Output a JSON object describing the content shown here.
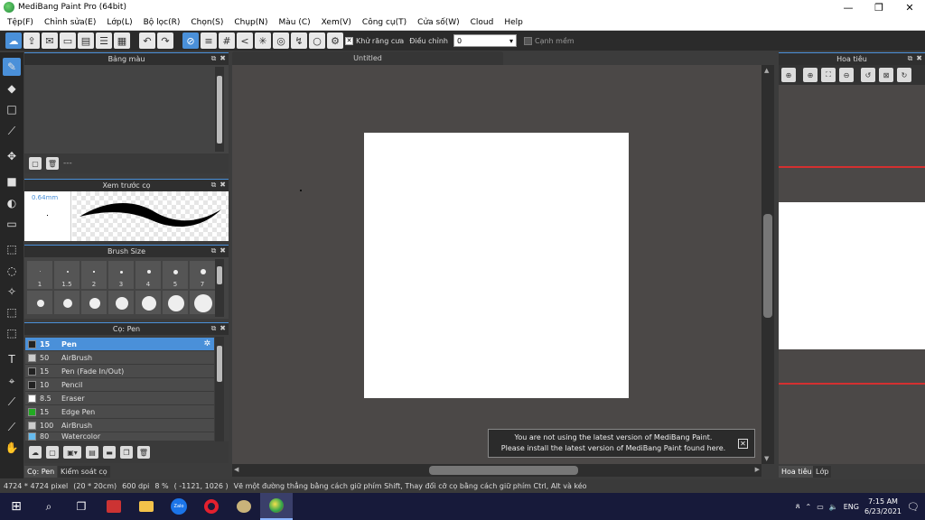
{
  "window": {
    "title": "MediBang Paint Pro (64bit)",
    "controls": [
      "—",
      "❐",
      "✕"
    ]
  },
  "menu": [
    "Tệp(F)",
    "Chỉnh sửa(E)",
    "Lớp(L)",
    "Bộ lọc(R)",
    "Chọn(S)",
    "Chụp(N)",
    "Màu (C)",
    "Xem(V)",
    "Công cụ(T)",
    "Cửa số(W)",
    "Cloud",
    "Help"
  ],
  "toolbar": {
    "antialias_label": "Khử răng cưa",
    "adjust_label": "Điều chỉnh",
    "adjust_value": "0",
    "edge_label": "Cạnh mềm"
  },
  "panels": {
    "color": {
      "title": "Bảng màu",
      "footer_text": "---"
    },
    "brush_preview": {
      "title": "Xem trước cọ",
      "size_text": "0.64mm"
    },
    "brush_size": {
      "title": "Brush Size",
      "sizes_row1": [
        "1",
        "1.5",
        "2",
        "3",
        "4",
        "5",
        "7"
      ]
    },
    "brush_list": {
      "title": "Cọ: Pen",
      "items": [
        {
          "size": "15",
          "name": "Pen",
          "color": "#222222",
          "selected": true
        },
        {
          "size": "50",
          "name": "AirBrush",
          "color": "#cccccc",
          "selected": false
        },
        {
          "size": "15",
          "name": "Pen (Fade In/Out)",
          "color": "#222222",
          "selected": false
        },
        {
          "size": "10",
          "name": "Pencil",
          "color": "#222222",
          "selected": false
        },
        {
          "size": "8.5",
          "name": "Eraser",
          "color": "#ffffff",
          "selected": false
        },
        {
          "size": "15",
          "name": "Edge Pen",
          "color": "#22aa22",
          "selected": false
        },
        {
          "size": "100",
          "name": "AirBrush",
          "color": "#cccccc",
          "selected": false
        },
        {
          "size": "80",
          "name": "Watercolor",
          "color": "#66bbee",
          "selected": false
        }
      ]
    },
    "bottom_tabs_left": [
      "Cọ: Pen",
      "Kiểm soát cọ"
    ],
    "navigator": {
      "title": "Hoa tiêu"
    },
    "bottom_tabs_right": [
      "Hoa tiêu",
      "Lớp"
    ]
  },
  "canvas": {
    "tab_title": "Untitled"
  },
  "notice": {
    "line1": "You are not using the latest version of MediBang Paint.",
    "line2": "Please install the latest version of MediBang Paint found here."
  },
  "status": {
    "size": "4724 * 4724 pixel",
    "physical": "(20 * 20cm)",
    "dpi": "600 dpi",
    "zoom": "8 %",
    "coords": "( -1121, 1026 )",
    "hint": "Vẽ một đường thẳng bằng cách giữ phím Shift, Thay đổi cỡ cọ bằng cách giữ phím Ctrl, Alt và kéo"
  },
  "taskbar": {
    "lang": "ENG",
    "time": "7:15 AM",
    "date": "6/23/2021",
    "zalo_label": "Zalo"
  }
}
